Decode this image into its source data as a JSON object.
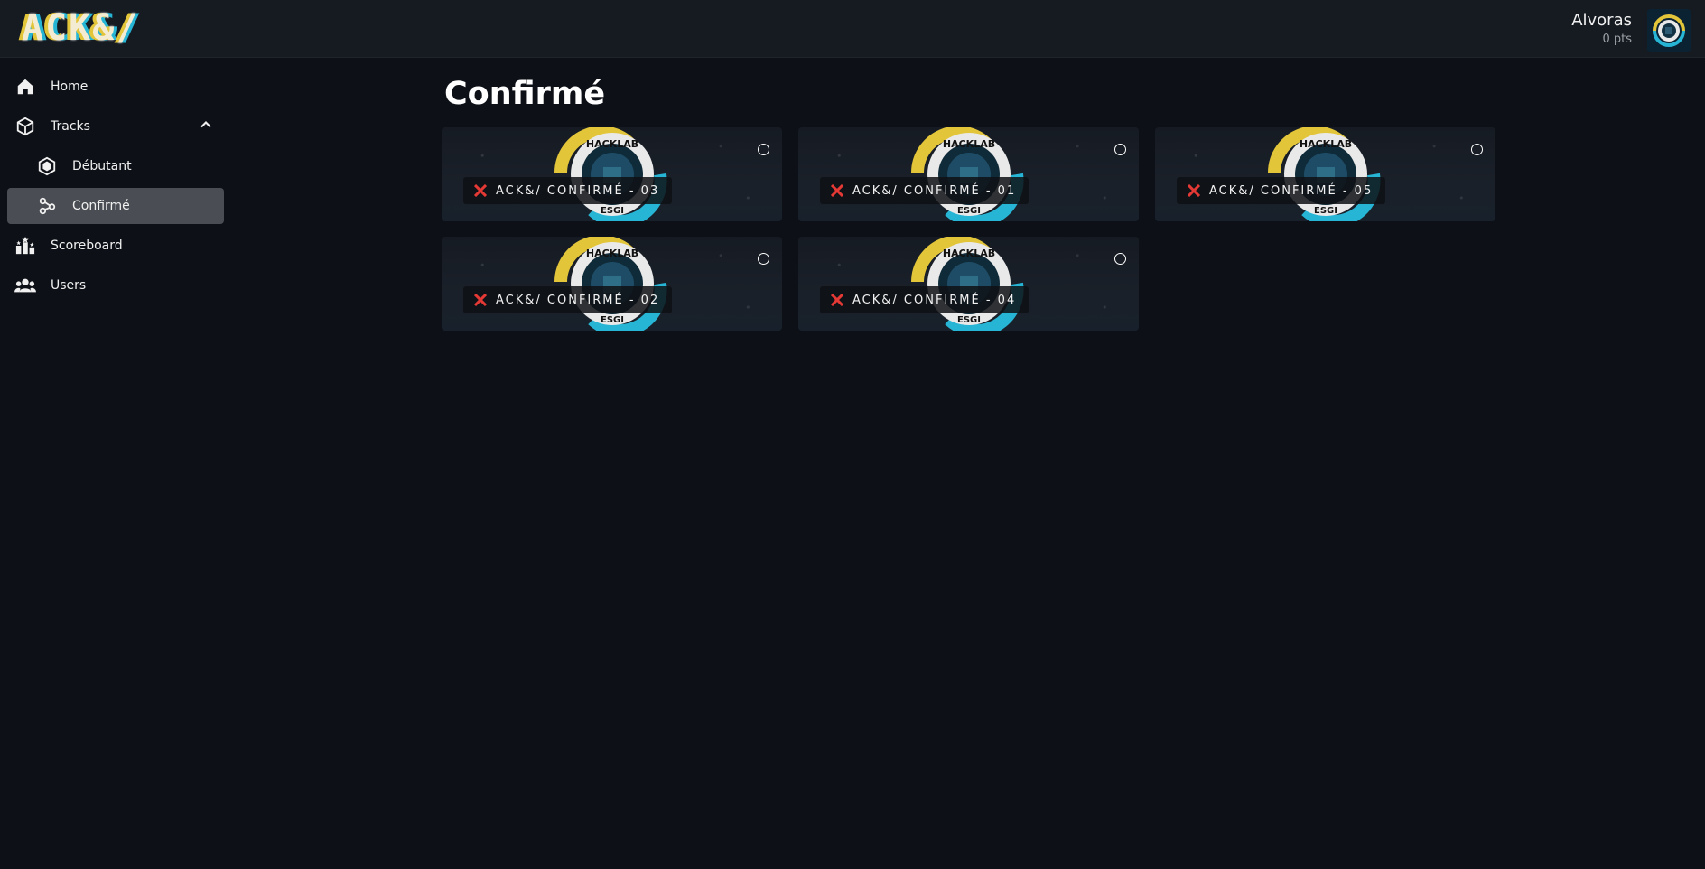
{
  "header": {
    "logo_text": "ACK&/",
    "user_name": "Alvoras",
    "user_points": "0 pts"
  },
  "sidebar": {
    "items": [
      {
        "label": "Home",
        "icon": "home-icon"
      },
      {
        "label": "Tracks",
        "icon": "cube-icon",
        "expanded": true
      },
      {
        "label": "Débutant",
        "icon": "hexagon-icon"
      },
      {
        "label": "Confirmé",
        "icon": "molecule-icon",
        "active": true
      },
      {
        "label": "Scoreboard",
        "icon": "podium-icon"
      },
      {
        "label": "Users",
        "icon": "users-icon"
      }
    ]
  },
  "main": {
    "title": "Confirmé",
    "challenges": [
      {
        "label": "ACK&/ CONFIRMÉ - 03",
        "solved": false
      },
      {
        "label": "ACK&/ CONFIRMÉ - 01",
        "solved": false
      },
      {
        "label": "ACK&/ CONFIRMÉ - 05",
        "solved": false
      },
      {
        "label": "ACK&/ CONFIRMÉ - 02",
        "solved": false
      },
      {
        "label": "ACK&/ CONFIRMÉ - 04",
        "solved": false
      }
    ]
  },
  "colors": {
    "background": "#0d1117",
    "topbar": "#161b22",
    "active_item": "#4a4e54",
    "logo_yellow": "#e3c53a",
    "logo_cyan": "#27b5d6",
    "status_red": "#e53935"
  }
}
